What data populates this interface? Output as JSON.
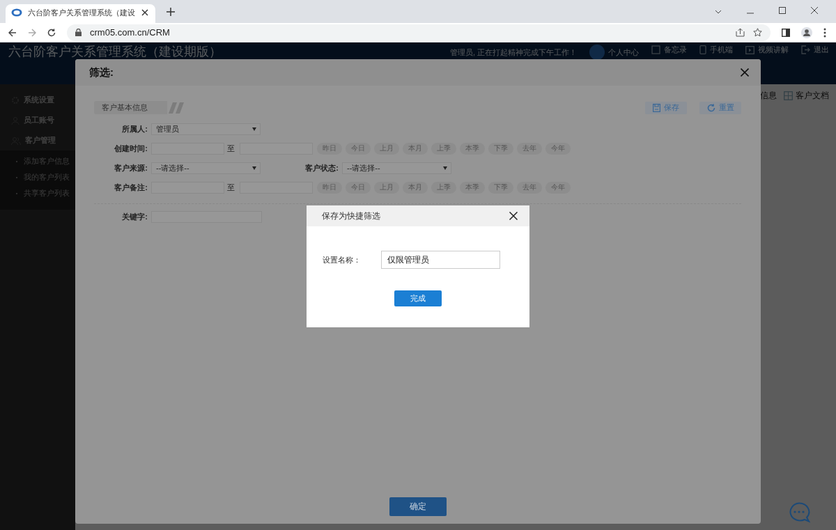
{
  "browser": {
    "tab_title": "六台阶客户关系管理系统（建设",
    "url": "crm05.com.cn/CRM"
  },
  "app": {
    "title": "六台阶客户关系管理系统（建设期版）",
    "greeting": "管理员, 正在打起精神完成下午工作！",
    "header_links": [
      {
        "label": "个人中心",
        "kind": "avatar"
      },
      {
        "label": "备忘录",
        "kind": "memo"
      },
      {
        "label": "手机端",
        "kind": "phone"
      },
      {
        "label": "视频讲解",
        "kind": "video"
      },
      {
        "label": "退出",
        "kind": "exit"
      }
    ],
    "sub_tabs": [
      {
        "label": "信息",
        "kind": "none"
      },
      {
        "label": "客户文档",
        "kind": "doc"
      }
    ],
    "sidebar": [
      {
        "label": "系统设置",
        "kind": "gear"
      },
      {
        "label": "员工账号",
        "kind": "user"
      },
      {
        "label": "客户管理",
        "kind": "users",
        "children": [
          {
            "label": "添加客户信息"
          },
          {
            "label": "我的客户列表"
          },
          {
            "label": "共享客户列表"
          }
        ]
      }
    ]
  },
  "filter_dialog": {
    "title": "筛选:",
    "section": "客户基本信息",
    "actions": [
      {
        "label": "保存",
        "kind": "save"
      },
      {
        "label": "重置",
        "kind": "reset"
      }
    ],
    "rows": [
      {
        "kind": "select",
        "label": "所属人:",
        "value": "管理员"
      },
      {
        "kind": "range",
        "label": "创建时间:",
        "separator": "至",
        "chips": [
          "昨日",
          "今日",
          "上月",
          "本月",
          "上季",
          "本季",
          "下季",
          "去年",
          "今年"
        ]
      },
      {
        "kind": "select2",
        "label": "客户来源:",
        "value": "--请选择--",
        "label2": "客户状态:",
        "value2": "--请选择--"
      },
      {
        "kind": "range",
        "label": "客户备注:",
        "separator": "至",
        "chips": [
          "昨日",
          "今日",
          "上月",
          "本月",
          "上季",
          "本季",
          "下季",
          "去年",
          "今年"
        ]
      },
      {
        "kind": "divider"
      },
      {
        "kind": "input",
        "label": "关键字:"
      }
    ],
    "confirm": "确定"
  },
  "save_dialog": {
    "title": "保存为快捷筛选",
    "label": "设置名称：",
    "value": "仅限管理员",
    "button": "完成"
  }
}
